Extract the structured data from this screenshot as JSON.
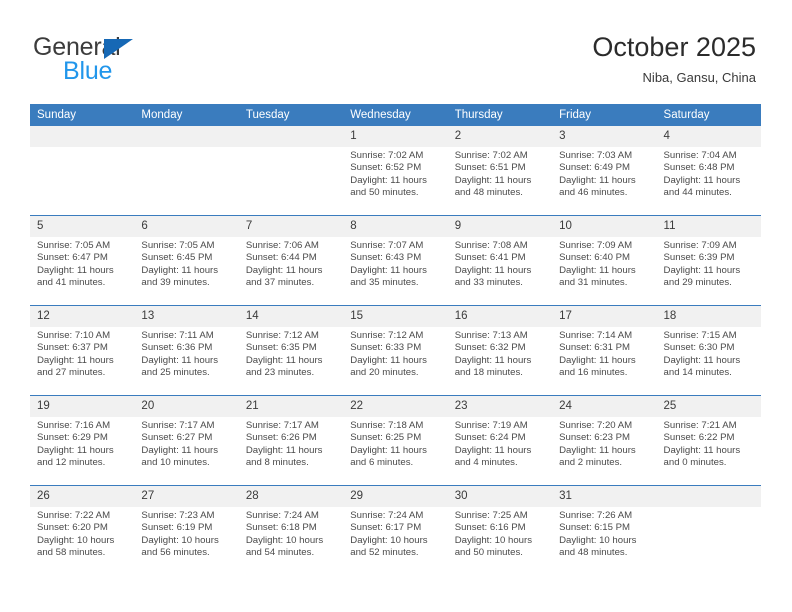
{
  "brand": {
    "word1": "General",
    "word2": "Blue",
    "triangle_color": "#1668b5",
    "blue_color": "#2196eb"
  },
  "header": {
    "title": "October 2025",
    "location": "Niba, Gansu, China"
  },
  "theme": {
    "header_blue": "#3a7cbe",
    "daynum_gray": "#f1f1f1"
  },
  "weekdays": [
    "Sunday",
    "Monday",
    "Tuesday",
    "Wednesday",
    "Thursday",
    "Friday",
    "Saturday"
  ],
  "labels": {
    "sunrise": "Sunrise:",
    "sunset": "Sunset:",
    "daylight": "Daylight:"
  },
  "weeks": [
    [
      {
        "day": "",
        "empty": true
      },
      {
        "day": "",
        "empty": true
      },
      {
        "day": "",
        "empty": true
      },
      {
        "day": "1",
        "sunrise": "Sunrise: 7:02 AM",
        "sunset": "Sunset: 6:52 PM",
        "daylight": "Daylight: 11 hours and 50 minutes."
      },
      {
        "day": "2",
        "sunrise": "Sunrise: 7:02 AM",
        "sunset": "Sunset: 6:51 PM",
        "daylight": "Daylight: 11 hours and 48 minutes."
      },
      {
        "day": "3",
        "sunrise": "Sunrise: 7:03 AM",
        "sunset": "Sunset: 6:49 PM",
        "daylight": "Daylight: 11 hours and 46 minutes."
      },
      {
        "day": "4",
        "sunrise": "Sunrise: 7:04 AM",
        "sunset": "Sunset: 6:48 PM",
        "daylight": "Daylight: 11 hours and 44 minutes."
      }
    ],
    [
      {
        "day": "5",
        "sunrise": "Sunrise: 7:05 AM",
        "sunset": "Sunset: 6:47 PM",
        "daylight": "Daylight: 11 hours and 41 minutes."
      },
      {
        "day": "6",
        "sunrise": "Sunrise: 7:05 AM",
        "sunset": "Sunset: 6:45 PM",
        "daylight": "Daylight: 11 hours and 39 minutes."
      },
      {
        "day": "7",
        "sunrise": "Sunrise: 7:06 AM",
        "sunset": "Sunset: 6:44 PM",
        "daylight": "Daylight: 11 hours and 37 minutes."
      },
      {
        "day": "8",
        "sunrise": "Sunrise: 7:07 AM",
        "sunset": "Sunset: 6:43 PM",
        "daylight": "Daylight: 11 hours and 35 minutes."
      },
      {
        "day": "9",
        "sunrise": "Sunrise: 7:08 AM",
        "sunset": "Sunset: 6:41 PM",
        "daylight": "Daylight: 11 hours and 33 minutes."
      },
      {
        "day": "10",
        "sunrise": "Sunrise: 7:09 AM",
        "sunset": "Sunset: 6:40 PM",
        "daylight": "Daylight: 11 hours and 31 minutes."
      },
      {
        "day": "11",
        "sunrise": "Sunrise: 7:09 AM",
        "sunset": "Sunset: 6:39 PM",
        "daylight": "Daylight: 11 hours and 29 minutes."
      }
    ],
    [
      {
        "day": "12",
        "sunrise": "Sunrise: 7:10 AM",
        "sunset": "Sunset: 6:37 PM",
        "daylight": "Daylight: 11 hours and 27 minutes."
      },
      {
        "day": "13",
        "sunrise": "Sunrise: 7:11 AM",
        "sunset": "Sunset: 6:36 PM",
        "daylight": "Daylight: 11 hours and 25 minutes."
      },
      {
        "day": "14",
        "sunrise": "Sunrise: 7:12 AM",
        "sunset": "Sunset: 6:35 PM",
        "daylight": "Daylight: 11 hours and 23 minutes."
      },
      {
        "day": "15",
        "sunrise": "Sunrise: 7:12 AM",
        "sunset": "Sunset: 6:33 PM",
        "daylight": "Daylight: 11 hours and 20 minutes."
      },
      {
        "day": "16",
        "sunrise": "Sunrise: 7:13 AM",
        "sunset": "Sunset: 6:32 PM",
        "daylight": "Daylight: 11 hours and 18 minutes."
      },
      {
        "day": "17",
        "sunrise": "Sunrise: 7:14 AM",
        "sunset": "Sunset: 6:31 PM",
        "daylight": "Daylight: 11 hours and 16 minutes."
      },
      {
        "day": "18",
        "sunrise": "Sunrise: 7:15 AM",
        "sunset": "Sunset: 6:30 PM",
        "daylight": "Daylight: 11 hours and 14 minutes."
      }
    ],
    [
      {
        "day": "19",
        "sunrise": "Sunrise: 7:16 AM",
        "sunset": "Sunset: 6:29 PM",
        "daylight": "Daylight: 11 hours and 12 minutes."
      },
      {
        "day": "20",
        "sunrise": "Sunrise: 7:17 AM",
        "sunset": "Sunset: 6:27 PM",
        "daylight": "Daylight: 11 hours and 10 minutes."
      },
      {
        "day": "21",
        "sunrise": "Sunrise: 7:17 AM",
        "sunset": "Sunset: 6:26 PM",
        "daylight": "Daylight: 11 hours and 8 minutes."
      },
      {
        "day": "22",
        "sunrise": "Sunrise: 7:18 AM",
        "sunset": "Sunset: 6:25 PM",
        "daylight": "Daylight: 11 hours and 6 minutes."
      },
      {
        "day": "23",
        "sunrise": "Sunrise: 7:19 AM",
        "sunset": "Sunset: 6:24 PM",
        "daylight": "Daylight: 11 hours and 4 minutes."
      },
      {
        "day": "24",
        "sunrise": "Sunrise: 7:20 AM",
        "sunset": "Sunset: 6:23 PM",
        "daylight": "Daylight: 11 hours and 2 minutes."
      },
      {
        "day": "25",
        "sunrise": "Sunrise: 7:21 AM",
        "sunset": "Sunset: 6:22 PM",
        "daylight": "Daylight: 11 hours and 0 minutes."
      }
    ],
    [
      {
        "day": "26",
        "sunrise": "Sunrise: 7:22 AM",
        "sunset": "Sunset: 6:20 PM",
        "daylight": "Daylight: 10 hours and 58 minutes."
      },
      {
        "day": "27",
        "sunrise": "Sunrise: 7:23 AM",
        "sunset": "Sunset: 6:19 PM",
        "daylight": "Daylight: 10 hours and 56 minutes."
      },
      {
        "day": "28",
        "sunrise": "Sunrise: 7:24 AM",
        "sunset": "Sunset: 6:18 PM",
        "daylight": "Daylight: 10 hours and 54 minutes."
      },
      {
        "day": "29",
        "sunrise": "Sunrise: 7:24 AM",
        "sunset": "Sunset: 6:17 PM",
        "daylight": "Daylight: 10 hours and 52 minutes."
      },
      {
        "day": "30",
        "sunrise": "Sunrise: 7:25 AM",
        "sunset": "Sunset: 6:16 PM",
        "daylight": "Daylight: 10 hours and 50 minutes."
      },
      {
        "day": "31",
        "sunrise": "Sunrise: 7:26 AM",
        "sunset": "Sunset: 6:15 PM",
        "daylight": "Daylight: 10 hours and 48 minutes."
      },
      {
        "day": "",
        "empty": true
      }
    ]
  ]
}
